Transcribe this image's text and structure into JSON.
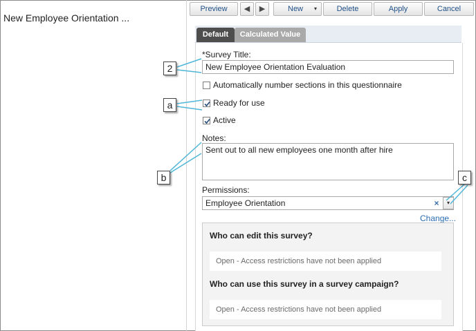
{
  "left_panel": {
    "title": "New Employee Orientation ..."
  },
  "toolbar": {
    "preview_label": "Preview",
    "prev_icon": "◀",
    "next_icon": "▶",
    "new_label": "New",
    "new_caret": "▾",
    "delete_label": "Delete",
    "apply_label": "Apply",
    "cancel_label": "Cancel"
  },
  "tabs": [
    {
      "label": "Default",
      "active": true
    },
    {
      "label": "Calculated Value",
      "active": false
    }
  ],
  "form": {
    "survey_title_label": "*Survey Title:",
    "survey_title_value": "New Employee Orientation Evaluation",
    "auto_number_label": "Automatically number sections in this questionnaire",
    "auto_number_checked": false,
    "ready_label": "Ready for use",
    "ready_checked": true,
    "active_label": "Active",
    "active_checked": true,
    "notes_label": "Notes:",
    "notes_value": "Sent out to all new employees one month after hire",
    "permissions_label": "Permissions:",
    "permissions_value": "Employee Orientation",
    "permissions_clear": "×",
    "permissions_caret": "▾",
    "change_link": "Change..."
  },
  "access": {
    "edit_heading": "Who can edit this survey?",
    "edit_note": "Open - Access restrictions have not been applied",
    "use_heading": "Who can use this survey in a survey campaign?",
    "use_note": "Open - Access restrictions have not been applied"
  },
  "callouts": {
    "two": "2",
    "a": "a",
    "b": "b",
    "c": "c"
  },
  "colors": {
    "link": "#2a6bb0",
    "tab_active": "#4e4e4e",
    "tab_inactive": "#a9a9a9",
    "callout_line": "#4fb6d8"
  }
}
